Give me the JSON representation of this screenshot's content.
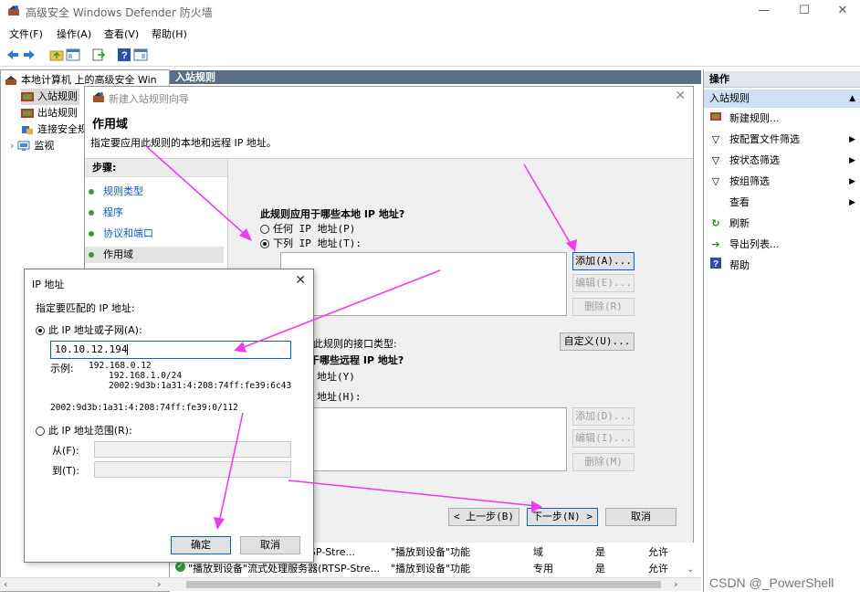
{
  "window": {
    "title": "高级安全 Windows Defender 防火墙",
    "min": "—",
    "max": "☐",
    "close": "✕"
  },
  "menu": [
    "文件(F)",
    "操作(A)",
    "查看(V)",
    "帮助(H)"
  ],
  "tree": {
    "root": "本地计算机 上的高级安全 Win",
    "items": [
      "入站规则",
      "出站规则",
      "连接安全规",
      "监视"
    ]
  },
  "center": {
    "header": "入站规则"
  },
  "rows": [
    {
      "name": "器(RTSP-Stre...",
      "group": "\"播放到设备\"功能",
      "profile": "域",
      "enabled": "是",
      "action": "允许"
    },
    {
      "name": "\"播放到设备\"流式处理服务器(RTSP-Stre...",
      "group": "\"播放到设备\"功能",
      "profile": "专用",
      "enabled": "是",
      "action": "允许"
    }
  ],
  "actions": {
    "header": "操作",
    "section": "入站规则",
    "items": [
      {
        "label": "新建规则...",
        "icon": "new-rule-icon",
        "arrow": ""
      },
      {
        "label": "按配置文件筛选",
        "icon": "filter-icon",
        "arrow": "▶"
      },
      {
        "label": "按状态筛选",
        "icon": "filter-icon",
        "arrow": "▶"
      },
      {
        "label": "按组筛选",
        "icon": "filter-icon",
        "arrow": "▶"
      },
      {
        "label": "查看",
        "icon": "",
        "arrow": "▶"
      },
      {
        "label": "刷新",
        "icon": "refresh-icon",
        "arrow": ""
      },
      {
        "label": "导出列表...",
        "icon": "export-icon",
        "arrow": ""
      },
      {
        "label": "帮助",
        "icon": "help-icon",
        "arrow": ""
      }
    ]
  },
  "wizard": {
    "title": "新建入站规则向导",
    "heading": "作用域",
    "description": "指定要应用此规则的本地和远程 IP 地址。",
    "steps_header": "步骤:",
    "steps": [
      "规则类型",
      "程序",
      "协议和端口",
      "作用域"
    ],
    "local_question": "此规则应用于哪些本地 IP 地址?",
    "local_any": "任何 IP 地址(P)",
    "local_list": "下列 IP 地址(T):",
    "add": "添加(A)...",
    "edit": "编辑(E)...",
    "remove": "删除(R)",
    "iface_text": "此规则的接口类型:",
    "customize": "自定义(U)...",
    "remote_question": "于哪些远程 IP 地址?",
    "remote_any": "地址(Y)",
    "remote_list": "地址(H):",
    "add2": "添加(D)...",
    "edit2": "编辑(I)...",
    "remove2": "删除(M)",
    "back": "< 上一步(B)",
    "next": "下一步(N) >",
    "cancel": "取消"
  },
  "ipdialog": {
    "title": "IP 地址",
    "prompt": "指定要匹配的 IP 地址:",
    "opt1": "此 IP 地址或子网(A):",
    "value": "10.10.12.194",
    "example_label": "示例:",
    "examples": [
      "192.168.0.12",
      "192.168.1.0/24",
      "2002:9d3b:1a31:4:208:74ff:fe39:6c43"
    ],
    "example_last": "2002:9d3b:1a31:4:208:74ff:fe39:0/112",
    "opt2": "此 IP 地址范围(R):",
    "from": "从(F):",
    "to": "到(T):",
    "ok": "确定",
    "cancel": "取消"
  },
  "watermark": "CSDN @_PowerShell",
  "colors": {
    "annotation": "#ee3bee",
    "panel_header": "#5a6f86",
    "selection": "#cfe0f4"
  }
}
